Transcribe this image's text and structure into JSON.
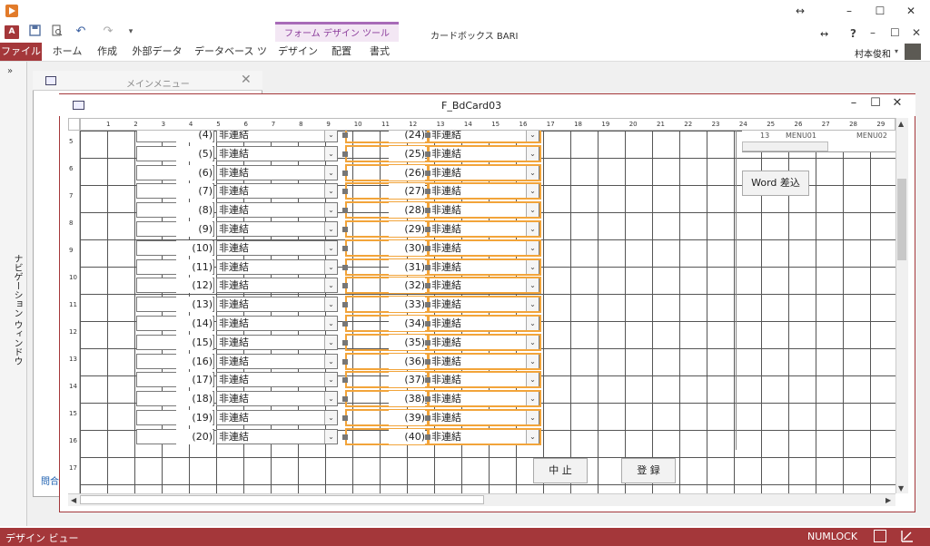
{
  "window": {
    "document_title": "カードボックス BARI",
    "resize_glyph": "↔",
    "minimize": "–",
    "maximize": "☐",
    "close": "✕"
  },
  "qat": {
    "access_badge": "A"
  },
  "ribbon": {
    "context_header": "フォーム デザイン ツール",
    "tabs": [
      "ファイル",
      "ホーム",
      "作成",
      "外部データ",
      "データベース ツール",
      "デザイン",
      "配置",
      "書式"
    ],
    "help": "?",
    "user_name": "村本俊和"
  },
  "nav_pane": {
    "title": "ナビゲーション ウィンドウ",
    "toggle": "»"
  },
  "menu_window": {
    "title": "メインメニュー",
    "close": "✕",
    "query_label": "問合"
  },
  "form_window": {
    "title": "F_BdCard03",
    "minimize": "–",
    "maximize": "☐",
    "close": "✕"
  },
  "ruler": {
    "h_ticks": [
      "1",
      "2",
      "3",
      "4",
      "5",
      "6",
      "7",
      "8",
      "9",
      "10",
      "11",
      "12",
      "13",
      "14",
      "15",
      "16",
      "17",
      "18",
      "19",
      "20",
      "21",
      "22",
      "23",
      "24",
      "25",
      "26",
      "27",
      "28",
      "29"
    ],
    "v_ticks": [
      "5",
      "6",
      "7",
      "8",
      "9",
      "10",
      "11",
      "12",
      "13",
      "14",
      "15",
      "16",
      "17"
    ]
  },
  "rows": [
    {
      "left_num": "(4)",
      "left_val": "非連結",
      "right_num": "(24)",
      "right_val": "非連結"
    },
    {
      "left_num": "(5)",
      "left_val": "非連結",
      "right_num": "(25)",
      "right_val": "非連結"
    },
    {
      "left_num": "(6)",
      "left_val": "非連結",
      "right_num": "(26)",
      "right_val": "非連結"
    },
    {
      "left_num": "(7)",
      "left_val": "非連結",
      "right_num": "(27)",
      "right_val": "非連結"
    },
    {
      "left_num": "(8)",
      "left_val": "非連結",
      "right_num": "(28)",
      "right_val": "非連結"
    },
    {
      "left_num": "(9)",
      "left_val": "非連結",
      "right_num": "(29)",
      "right_val": "非連結"
    },
    {
      "left_num": "(10)",
      "left_val": "非連結",
      "right_num": "(30)",
      "right_val": "非連結"
    },
    {
      "left_num": "(11)",
      "left_val": "非連結",
      "right_num": "(31)",
      "right_val": "非連結"
    },
    {
      "left_num": "(12)",
      "left_val": "非連結",
      "right_num": "(32)",
      "right_val": "非連結"
    },
    {
      "left_num": "(13)",
      "left_val": "非連結",
      "right_num": "(33)",
      "right_val": "非連結"
    },
    {
      "left_num": "(14)",
      "left_val": "非連結",
      "right_num": "(34)",
      "right_val": "非連結"
    },
    {
      "left_num": "(15)",
      "left_val": "非連結",
      "right_num": "(35)",
      "right_val": "非連結"
    },
    {
      "left_num": "(16)",
      "left_val": "非連結",
      "right_num": "(36)",
      "right_val": "非連結"
    },
    {
      "left_num": "(17)",
      "left_val": "非連結",
      "right_num": "(37)",
      "right_val": "非連結"
    },
    {
      "left_num": "(18)",
      "left_val": "非連結",
      "right_num": "(38)",
      "right_val": "非連結"
    },
    {
      "left_num": "(19)",
      "left_val": "非連結",
      "right_num": "(39)",
      "right_val": "非連結"
    },
    {
      "left_num": "(20)",
      "left_val": "非連結",
      "right_num": "(40)",
      "right_val": "非連結"
    }
  ],
  "combo_arrow": "⌄",
  "subform": {
    "text1": "MENU01",
    "text2": "MENU02",
    "text3": "13"
  },
  "buttons": {
    "word": "Word 差込",
    "cancel": "中 止",
    "register": "登 録"
  },
  "status": {
    "view": "デザイン ビュー",
    "numlock": "NUMLOCK"
  },
  "colors": {
    "accent": "#a4373a",
    "selection": "#f2a43a",
    "context_tab": "#8a3a9a"
  }
}
